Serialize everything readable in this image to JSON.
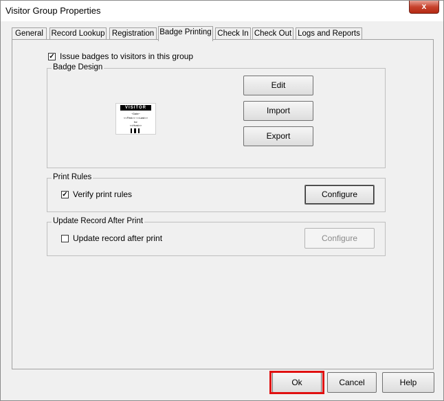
{
  "window": {
    "title": "Visitor Group Properties",
    "close_glyph": "x"
  },
  "tabs": [
    {
      "label": "General"
    },
    {
      "label": "Record Lookup"
    },
    {
      "label": "Registration"
    },
    {
      "label": "Badge Printing",
      "selected": true
    },
    {
      "label": "Check In"
    },
    {
      "label": "Check Out"
    },
    {
      "label": "Logs and Reports"
    }
  ],
  "badge_printing": {
    "issue_badges": {
      "label": "Issue badges to visitors in this group",
      "checked": true
    },
    "badge_design": {
      "title": "Badge Design",
      "preview": {
        "header": "VISITOR",
        "line1": "~Date~",
        "line2": "<<First>> <<Last>>",
        "line3": "for",
        "line4": "<<Host>>"
      },
      "edit_label": "Edit",
      "import_label": "Import",
      "export_label": "Export"
    },
    "print_rules": {
      "title": "Print Rules",
      "verify": {
        "label": "Verify print rules",
        "checked": true
      },
      "configure_label": "Configure"
    },
    "update_record": {
      "title": "Update Record After Print",
      "update": {
        "label": "Update record after print",
        "checked": false
      },
      "configure_label": "Configure",
      "configure_enabled": false
    }
  },
  "footer": {
    "ok_label": "Ok",
    "cancel_label": "Cancel",
    "help_label": "Help",
    "highlight_color": "#e01010"
  }
}
